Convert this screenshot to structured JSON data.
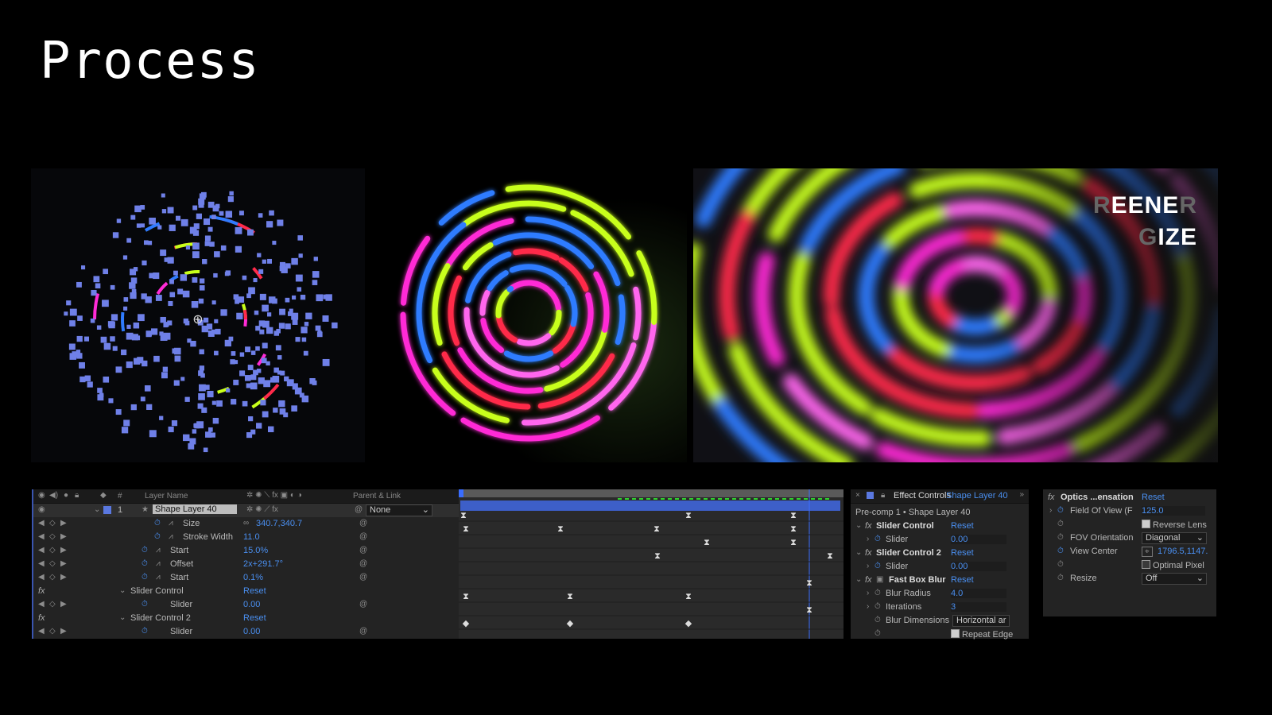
{
  "title": "Process",
  "render3": {
    "line1_dim_a": "R",
    "line1_main": "EENE",
    "line1_dim_b": "R",
    "line2_dim": "G",
    "line2_main": "IZE"
  },
  "timeline": {
    "header": {
      "num": "#",
      "layer_name": "Layer Name",
      "parent": "Parent & Link"
    },
    "layer": {
      "index": "1",
      "name": "Shape Layer 40",
      "parent": "None"
    },
    "rows": [
      {
        "label": "Size",
        "value": "340.7,340.7"
      },
      {
        "label": "Stroke Width",
        "value": "11.0"
      },
      {
        "label": "Start",
        "value": "15.0%"
      },
      {
        "label": "Offset",
        "value": "2x+291.7°"
      },
      {
        "label": "Start",
        "value": "0.1%"
      },
      {
        "label": "Slider Control",
        "value": "Reset"
      },
      {
        "label": "Slider",
        "value": "0.00"
      },
      {
        "label": "Slider Control 2",
        "value": "Reset"
      },
      {
        "label": "Slider",
        "value": "0.00"
      }
    ]
  },
  "effect_controls": {
    "title": "Effect Controls",
    "layer": "Shape Layer 40",
    "subtitle": "Pre-comp 1 • Shape Layer 40",
    "items": [
      {
        "label": "Slider Control",
        "value": "Reset"
      },
      {
        "label": "Slider",
        "value": "0.00"
      },
      {
        "label": "Slider Control 2",
        "value": "Reset"
      },
      {
        "label": "Slider",
        "value": "0.00"
      },
      {
        "label": "Fast Box Blur",
        "value": "Reset"
      },
      {
        "label": "Blur Radius",
        "value": "4.0"
      },
      {
        "label": "Iterations",
        "value": "3"
      },
      {
        "label": "Blur Dimensions",
        "value": "Horizontal ar"
      },
      {
        "label": "Repeat Edge",
        "value": ""
      }
    ]
  },
  "optics": {
    "title": "Optics ...ensation",
    "reset": "Reset",
    "field_of_view_label": "Field Of View (F",
    "field_of_view_value": "125.0",
    "reverse_lens": "Reverse Lens",
    "fov_orientation_label": "FOV Orientation",
    "fov_orientation_value": "Diagonal",
    "view_center_label": "View Center",
    "view_center_value": "1796.5,1147.",
    "optimal_pixel": "Optimal Pixel",
    "resize_label": "Resize",
    "resize_value": "Off"
  },
  "colors": {
    "magenta": "#ff2bd6",
    "lime": "#c8ff1a",
    "red": "#ff2a4a",
    "blue": "#2f7bff",
    "ae_blue": "#4a8ff0"
  }
}
